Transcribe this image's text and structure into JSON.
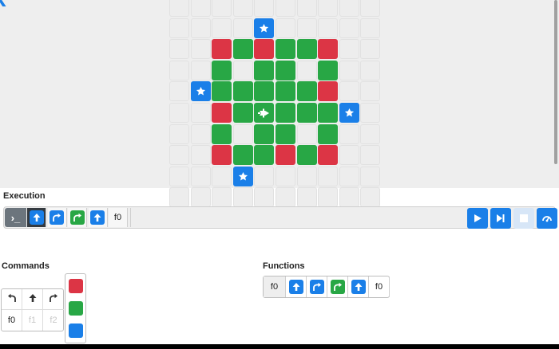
{
  "execution": {
    "label": "Execution",
    "terminal_symbol": "›_",
    "program": [
      {
        "type": "forward",
        "color": "blue",
        "icon": "up-arrow-icon"
      },
      {
        "type": "turn-right",
        "color": "blue",
        "icon": "turn-right-icon"
      },
      {
        "type": "turn-right",
        "color": "green",
        "icon": "turn-right-icon"
      },
      {
        "type": "forward",
        "color": "blue",
        "icon": "up-arrow-icon"
      },
      {
        "type": "call",
        "label": "f0"
      }
    ],
    "controls": [
      "play-icon",
      "step-icon",
      "stop-icon",
      "speed-icon"
    ]
  },
  "commands": {
    "label": "Commands",
    "moves": [
      "turn-left-icon",
      "up-arrow-icon",
      "turn-right-icon"
    ],
    "functions": [
      "f0",
      "f1",
      "f2"
    ],
    "function_enabled": [
      true,
      false,
      false
    ],
    "colors": [
      "#dc3545",
      "#28a745",
      "#1a7fe8"
    ]
  },
  "functions": {
    "label": "Functions",
    "rows": [
      {
        "name": "f0",
        "slots": [
          {
            "type": "forward",
            "color": "blue",
            "icon": "up-arrow-icon"
          },
          {
            "type": "turn-right",
            "color": "blue",
            "icon": "turn-right-icon"
          },
          {
            "type": "turn-right",
            "color": "green",
            "icon": "turn-right-icon"
          },
          {
            "type": "forward",
            "color": "blue",
            "icon": "up-arrow-icon"
          },
          {
            "type": "call",
            "label": "f0"
          }
        ]
      }
    ]
  },
  "board": {
    "rows": [
      "........",
      "....S...",
      "..RGRGGR",
      "..G.GG.G",
      ".SGGGGGR",
      "..RGGGGGS",
      "..G.GG.G",
      "..RGGRGR",
      "...S....",
      "........"
    ],
    "legend": {
      "R": "red",
      "G": "green",
      "S": "star",
      ".": "empty",
      "B": "ship"
    },
    "ship": {
      "row": 5,
      "col": 4,
      "icon": "ship-icon"
    },
    "colors": {
      "red": "#dc3545",
      "green": "#28a745",
      "blue": "#1a7fe8",
      "empty": "#ededed"
    }
  }
}
